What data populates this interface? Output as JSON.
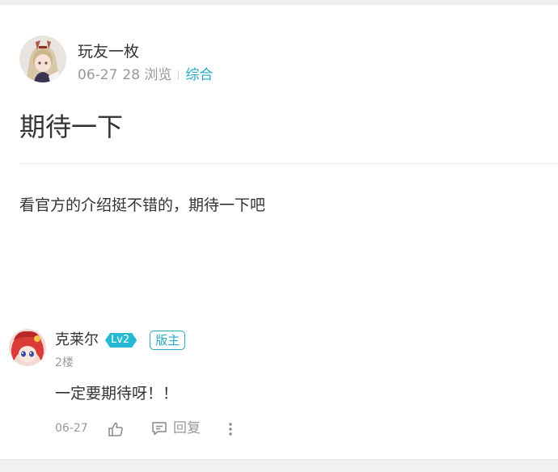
{
  "post": {
    "author": {
      "name": "玩友一枚",
      "avatar_icon": "anime-girl-avatar-icon"
    },
    "date": "06-27",
    "views": "28 浏览",
    "category": "综合",
    "title": "期待一下",
    "body": "看官方的介绍挺不错的，期待一下吧"
  },
  "reply": {
    "user": {
      "name": "克莱尔",
      "level": "Lv2",
      "role_badge": "版主",
      "avatar_icon": "red-hair-girl-avatar-icon"
    },
    "floor": "2楼",
    "text": "一定要期待呀！！",
    "date": "06-27",
    "reply_label": "回复"
  },
  "colors": {
    "accent": "#27a7c4",
    "level_badge": "#27b9d4",
    "meta_text": "#999999",
    "main_text": "#333333"
  }
}
